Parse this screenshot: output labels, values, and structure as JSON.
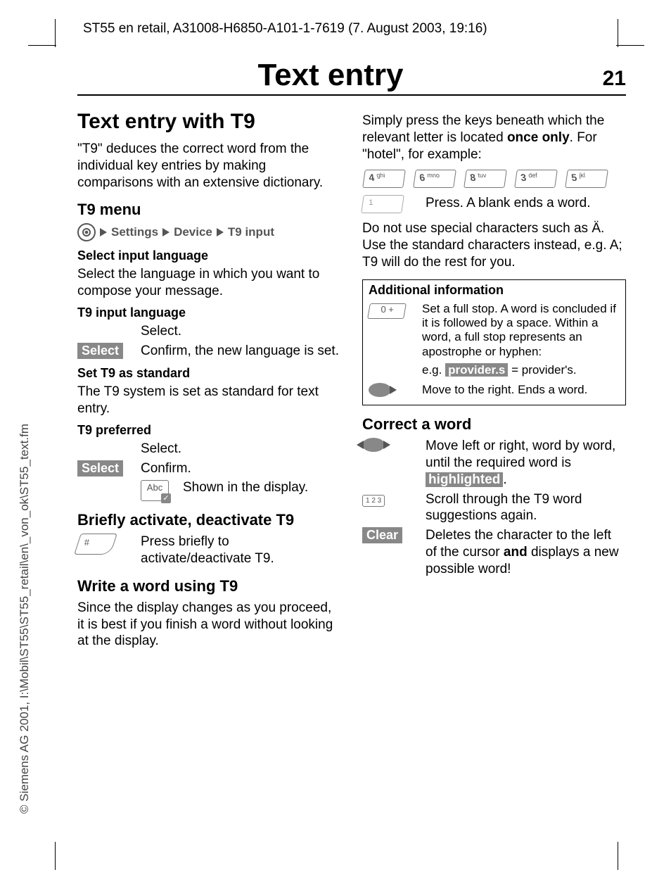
{
  "meta": {
    "header": "ST55 en retail, A31008-H6850-A101-1-7619 (7. August 2003, 19:16)",
    "copyright": "© Siemens AG 2001, I:\\Mobil\\ST55\\ST55_retail\\en\\_von_ok\\ST55_text.fm",
    "page_title": "Text entry",
    "page_number": "21"
  },
  "left": {
    "h1": "Text entry with T9",
    "intro": "\"T9\" deduces the correct word from the individual key entries by making comparisons with an extensive dictionary.",
    "t9menu": "T9 menu",
    "nav": {
      "a": "Settings",
      "b": "Device",
      "c": "T9 input"
    },
    "sel_lang_head": "Select input language",
    "sel_lang_body": "Select the language in which you want to compose your message.",
    "t9_input_lang": "T9 input language",
    "select_text": "Select.",
    "softkey_select": "Select",
    "confirm_new_lang": "Confirm, the new language is set.",
    "set_std_head": "Set T9 as standard",
    "set_std_body": "The T9 system is set as standard for text entry.",
    "t9_pref": "T9 preferred",
    "confirm": "Confirm.",
    "abc_label": "Abc",
    "shown_display": "Shown in the display.",
    "brief_head": "Briefly activate, deactivate T9",
    "brief_body": "Press briefly to activate/deactivate T9.",
    "write_head": "Write a word using T9",
    "write_body": "Since the display changes as you proceed, it is best if you finish a word without looking at the display."
  },
  "right": {
    "intro1": "Simply press the keys beneath which the relevant letter is located ",
    "once_only": "once only",
    "intro2": ". For \"hotel\", for example:",
    "keys": [
      {
        "n": "4",
        "l": "ghi"
      },
      {
        "n": "6",
        "l": "mno"
      },
      {
        "n": "8",
        "l": "tuv"
      },
      {
        "n": "3",
        "l": "def"
      },
      {
        "n": "5",
        "l": "jkl"
      }
    ],
    "press_blank": "Press. A blank ends a word.",
    "no_special": "Do not use special characters such as Ä. Use the standard characters instead, e.g. A; T9 will do the rest for you.",
    "info_head": "Additional information",
    "zero_key": "0 +",
    "zero_body": "Set a full stop. A word is concluded if it is followed by a space. Within a word, a full stop represents an apostrophe or hyphen:",
    "eg": "e.g. ",
    "providers": "provider.s",
    "providers_eq": " = provider's.",
    "move_right": "Move to the right. Ends a word.",
    "correct_head": "Correct a word",
    "corr1a": "Move left or right, word by word, until the required word is ",
    "highlighted": "highlighted",
    "corr1b": ".",
    "triple": "1 2 3",
    "corr2": "Scroll through the T9 word suggestions again.",
    "clear": "Clear",
    "corr3a": "Deletes the character to the left of the cursor ",
    "and": "and",
    "corr3b": " displays a new possible word!"
  }
}
